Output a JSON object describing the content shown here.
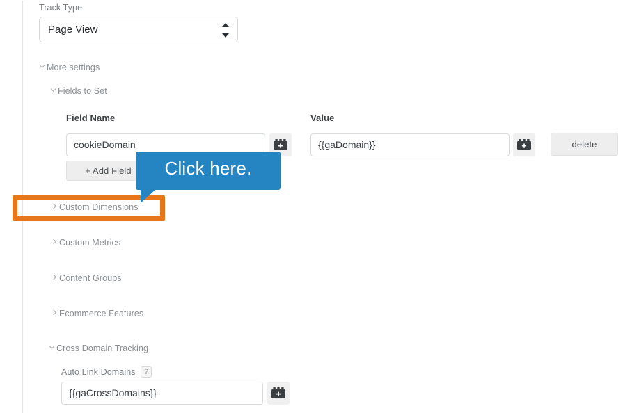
{
  "track_type": {
    "label": "Track Type",
    "value": "Page View",
    "stepper_icon": "stepper-arrows-icon"
  },
  "sections": {
    "more_settings": {
      "label": "More settings",
      "chevron": "chevron-down-icon",
      "expanded": true
    },
    "fields_to_set": {
      "label": "Fields to Set",
      "chevron": "chevron-down-icon",
      "expanded": true
    },
    "custom_dimensions": {
      "label": "Custom Dimensions",
      "chevron": "chevron-right-icon",
      "expanded": false
    },
    "custom_metrics": {
      "label": "Custom Metrics",
      "chevron": "chevron-right-icon",
      "expanded": false
    },
    "content_groups": {
      "label": "Content Groups",
      "chevron": "chevron-right-icon",
      "expanded": false
    },
    "ecommerce_features": {
      "label": "Ecommerce Features",
      "chevron": "chevron-right-icon",
      "expanded": false
    },
    "cross_domain_tracking": {
      "label": "Cross Domain Tracking",
      "chevron": "chevron-down-icon",
      "expanded": true
    }
  },
  "fields_table": {
    "headers": {
      "field_name": "Field Name",
      "value": "Value"
    },
    "rows": [
      {
        "field_name": "cookieDomain",
        "value": "{{gaDomain}}",
        "field_name_variable_icon": "lego-brick-plus-icon",
        "value_variable_icon": "lego-brick-plus-icon",
        "delete_label": "delete"
      }
    ],
    "add_field_label": "+ Add Field"
  },
  "cross_domain": {
    "auto_link_domains_label": "Auto Link Domains",
    "help_icon": "question-mark-icon",
    "help_glyph": "?",
    "auto_link_domains_value": "{{gaCrossDomains}}",
    "variable_icon": "lego-brick-plus-icon"
  },
  "callout": {
    "text": "Click here.",
    "color": "#2585c2"
  },
  "highlight": {
    "color": "#e8761a",
    "target": "Custom Dimensions"
  }
}
